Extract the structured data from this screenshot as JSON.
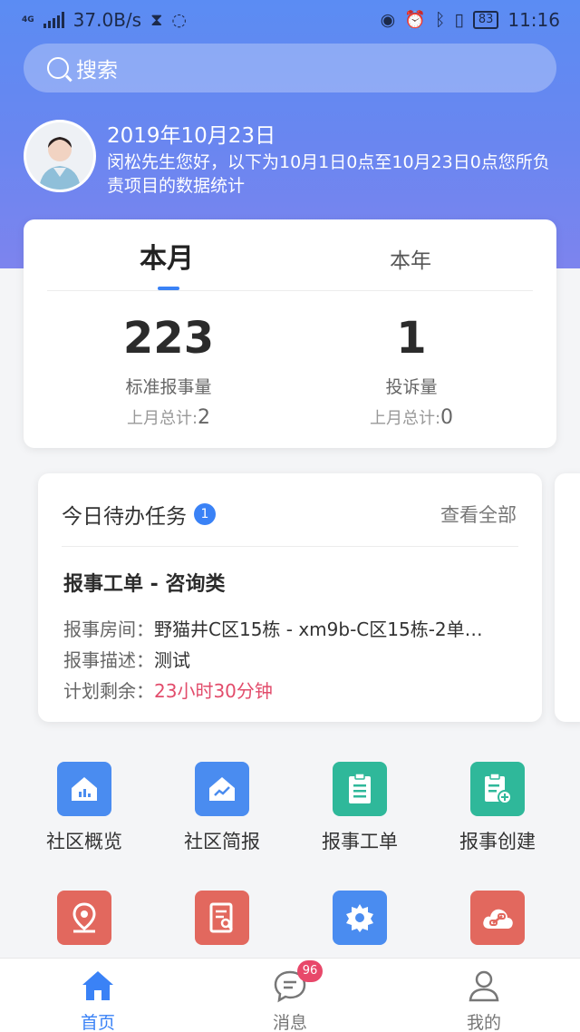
{
  "status_bar": {
    "network": "4G",
    "speed": "37.0B/s",
    "battery": "83",
    "time": "11:16"
  },
  "search": {
    "placeholder": "搜索"
  },
  "greeting": {
    "date": "2019年10月23日",
    "text": "闵松先生您好，以下为10月1日0点至10月23日0点您所负责项目的数据统计"
  },
  "stats": {
    "tabs": [
      "本月",
      "本年"
    ],
    "active_tab": "本月",
    "items": [
      {
        "value": "223",
        "label": "标准报事量",
        "prev_label": "上月总计:",
        "prev_value": "2"
      },
      {
        "value": "1",
        "label": "投诉量",
        "prev_label": "上月总计:",
        "prev_value": "0"
      }
    ]
  },
  "tasks": {
    "title": "今日待办任务",
    "count": "1",
    "view_all": "查看全部",
    "order": {
      "title": "报事工单 - 咨询类",
      "room_label": "报事房间：",
      "room_value": "野猫井C区15栋 - xm9b-C区15栋-2单…",
      "desc_label": "报事描述：",
      "desc_value": "测试",
      "remain_label": "计划剩余：",
      "remain_value": "23小时30分钟"
    }
  },
  "grid": [
    {
      "label": "社区概览",
      "icon": "house-chart-icon",
      "color": "#4a8cf0"
    },
    {
      "label": "社区简报",
      "icon": "house-trend-icon",
      "color": "#4a8cf0"
    },
    {
      "label": "报事工单",
      "icon": "clipboard-list-icon",
      "color": "#2fb89a"
    },
    {
      "label": "报事创建",
      "icon": "clipboard-add-icon",
      "color": "#2fb89a"
    },
    {
      "label": "",
      "icon": "location-pin-icon",
      "color": "#e2685e"
    },
    {
      "label": "",
      "icon": "document-search-icon",
      "color": "#e2685e"
    },
    {
      "label": "",
      "icon": "gear-icon",
      "color": "#4a8cf0"
    },
    {
      "label": "",
      "icon": "cloud-link-icon",
      "color": "#e2685e"
    }
  ],
  "tabbar": {
    "items": [
      {
        "label": "首页",
        "icon": "home-icon",
        "active": true
      },
      {
        "label": "消息",
        "icon": "message-icon",
        "badge": "96"
      },
      {
        "label": "我的",
        "icon": "user-icon"
      }
    ]
  },
  "colors": {
    "accent": "#3a82f6",
    "hero_gradient_top": "#5b8cf3",
    "hero_gradient_bottom": "#7d84ee",
    "remain_text": "#e24c6b",
    "badge_red": "#e8486a"
  }
}
